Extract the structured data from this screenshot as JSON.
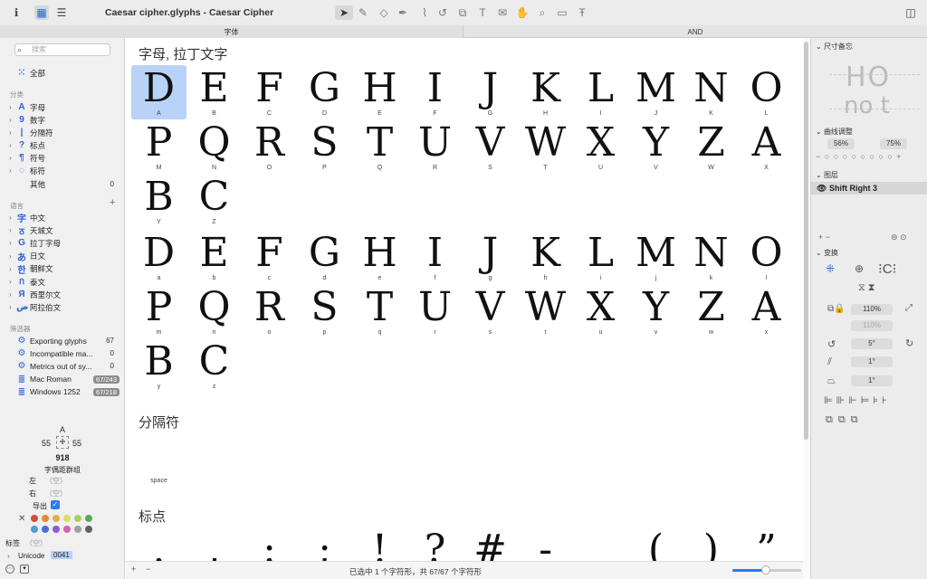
{
  "window": {
    "title": "Caesar cipher.glyphs - Caesar Cipher"
  },
  "tabs": [
    {
      "label": "字体"
    },
    {
      "label": "AND"
    }
  ],
  "search": {
    "placeholder": "搜索"
  },
  "sidebar": {
    "all_label": "全部",
    "categories_header": "分类",
    "categories": [
      {
        "icon": "A",
        "label": "字母"
      },
      {
        "icon": "9",
        "label": "数字"
      },
      {
        "icon": "|",
        "label": "分隔符"
      },
      {
        "icon": "?",
        "label": "标点"
      },
      {
        "icon": "¶",
        "label": "符号"
      },
      {
        "icon": "◌",
        "label": "标符"
      }
    ],
    "other_label": "其他",
    "other_count": "0",
    "languages_header": "语言",
    "languages": [
      {
        "icon": "字",
        "label": "中文"
      },
      {
        "icon": "ठ",
        "label": "天城文"
      },
      {
        "icon": "G",
        "label": "拉丁字母"
      },
      {
        "icon": "あ",
        "label": "日文"
      },
      {
        "icon": "한",
        "label": "朝鲜文"
      },
      {
        "icon": "ก",
        "label": "泰文"
      },
      {
        "icon": "Я",
        "label": "西里尔文"
      },
      {
        "icon": "ض",
        "label": "阿拉伯文"
      }
    ],
    "filters_header": "筛选器",
    "filters": [
      {
        "label": "Exporting glyphs",
        "count": "67"
      },
      {
        "label": "Incompatible ma...",
        "count": "0"
      },
      {
        "label": "Metrics out of sy...",
        "count": "0"
      },
      {
        "label": "Mac Roman",
        "badge": "67/243"
      },
      {
        "label": "Windows 1252",
        "badge": "67/218"
      }
    ]
  },
  "glyph_info": {
    "name": "A",
    "lsb": "55",
    "rsb": "55",
    "width": "918",
    "kerning_group_label": "字偶距群组",
    "left_label": "左",
    "left_value": "（空）",
    "right_label": "右",
    "right_value": "（空）",
    "export_label": "导出",
    "tags_label": "标签",
    "tags_value": "（空）",
    "unicode_label": "Unicode",
    "unicode_value": "0041"
  },
  "colors": [
    "#d44a3a",
    "#e8873a",
    "#e0b040",
    "#dcdc60",
    "#a8d060",
    "#58a858",
    "#4aa0d8",
    "#4a70d8",
    "#8e5ad8",
    "#d860b0",
    "#a0a0a0",
    "#606060"
  ],
  "main": {
    "sections": [
      {
        "title": "字母, 拉丁文字"
      },
      {
        "title": "分隔符"
      },
      {
        "title": "标点"
      }
    ],
    "upper_glyphs": [
      "D",
      "E",
      "F",
      "G",
      "H",
      "I",
      "J",
      "K",
      "L",
      "M",
      "N",
      "O",
      "P",
      "Q",
      "R",
      "S",
      "T",
      "U",
      "V",
      "W",
      "X",
      "Y",
      "Z",
      "A",
      "B",
      "C"
    ],
    "upper_names": [
      "A",
      "B",
      "C",
      "D",
      "E",
      "F",
      "G",
      "H",
      "I",
      "J",
      "K",
      "L",
      "M",
      "N",
      "O",
      "P",
      "Q",
      "R",
      "S",
      "T",
      "U",
      "V",
      "W",
      "X",
      "Y",
      "Z"
    ],
    "lower_glyphs": [
      "D",
      "E",
      "F",
      "G",
      "H",
      "I",
      "J",
      "K",
      "L",
      "M",
      "N",
      "O",
      "P",
      "Q",
      "R",
      "S",
      "T",
      "U",
      "V",
      "W",
      "X",
      "Y",
      "Z",
      "A",
      "B",
      "C"
    ],
    "lower_names": [
      "a",
      "b",
      "c",
      "d",
      "e",
      "f",
      "g",
      "h",
      "i",
      "j",
      "k",
      "l",
      "m",
      "n",
      "o",
      "p",
      "q",
      "r",
      "s",
      "t",
      "u",
      "v",
      "w",
      "x",
      "y",
      "z"
    ],
    "separator_name": "space",
    "punct_glyphs": [
      ".",
      ",",
      ":",
      ";",
      "!",
      "?",
      "#",
      "-",
      "",
      "(",
      ")",
      "”"
    ]
  },
  "status": {
    "text": "已选中 1 个字符形，共 67/67 个字符形"
  },
  "right_panel": {
    "dimensions_header": "尺寸备忘",
    "preview_top": "HO",
    "preview_bottom": "no t",
    "curve_header": "曲线调整",
    "curve_a": "56%",
    "curve_b": "75%",
    "layers_header": "图层",
    "layer_name": "Shift Right 3",
    "transform_header": "变换",
    "scale_x": "110%",
    "scale_y": "110%",
    "rotate": "5°",
    "slant1": "1°",
    "slant2": "1°"
  }
}
